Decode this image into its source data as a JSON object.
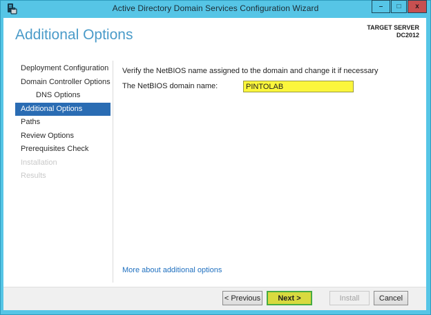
{
  "window": {
    "title": "Active Directory Domain Services Configuration Wizard",
    "controls": {
      "minimize": "–",
      "maximize": "□",
      "close": "x"
    }
  },
  "header": {
    "title": "Additional Options",
    "target_server_label": "TARGET SERVER",
    "target_server_name": "DC2012"
  },
  "sidebar": {
    "items": [
      {
        "label": "Deployment Configuration",
        "state": "normal",
        "indent": 0
      },
      {
        "label": "Domain Controller Options",
        "state": "normal",
        "indent": 0
      },
      {
        "label": "DNS Options",
        "state": "normal",
        "indent": 1
      },
      {
        "label": "Additional Options",
        "state": "selected",
        "indent": 0
      },
      {
        "label": "Paths",
        "state": "normal",
        "indent": 0
      },
      {
        "label": "Review Options",
        "state": "normal",
        "indent": 0
      },
      {
        "label": "Prerequisites Check",
        "state": "normal",
        "indent": 0
      },
      {
        "label": "Installation",
        "state": "disabled",
        "indent": 0
      },
      {
        "label": "Results",
        "state": "disabled",
        "indent": 0
      }
    ]
  },
  "main": {
    "instruction": "Verify the NetBIOS name assigned to the domain and change it if necessary",
    "field_label": "The NetBIOS domain name:",
    "field_value": "PINTOLAB",
    "link": "More about additional options"
  },
  "footer": {
    "buttons": [
      {
        "label": "< Previous",
        "state": "enabled"
      },
      {
        "label": "Next >",
        "state": "enabled-highlighted"
      },
      {
        "label": "Install",
        "state": "disabled"
      },
      {
        "label": "Cancel",
        "state": "enabled"
      }
    ]
  },
  "colors": {
    "window_chrome": "#56c5e6",
    "close_button": "#c75050",
    "heading_blue": "#4a9bc9",
    "selected_nav": "#2a6cb3",
    "link_blue": "#1e6fbf",
    "input_highlight": "#fbf63c",
    "next_button_highlight": "#d8da3f",
    "next_button_border": "#47ab44"
  }
}
